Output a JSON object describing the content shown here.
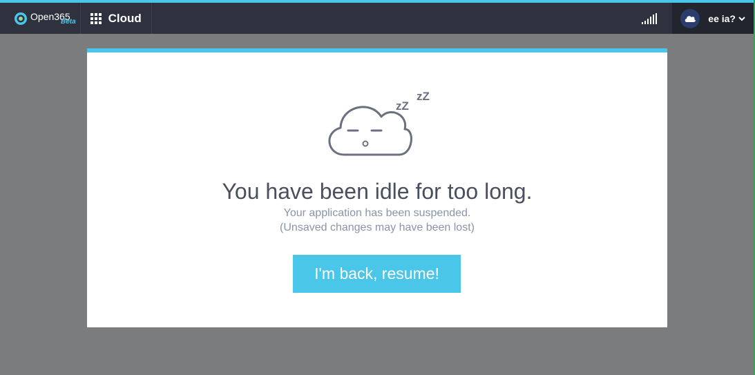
{
  "header": {
    "brand_name": "Open365",
    "brand_badge": "Beta",
    "app_label": "Cloud",
    "user_name": "ee ia?"
  },
  "colors": {
    "accent": "#4ac6e8",
    "topbar": "#2f323e",
    "backdrop": "#7b7c7e"
  },
  "idle": {
    "sleep_text_1": "zZ",
    "sleep_text_2": "zZ",
    "title": "You have been idle for too long.",
    "line1": "Your application has been suspended.",
    "line2": "(Unsaved changes may have been lost)",
    "resume_label": "I'm back, resume!"
  },
  "icons": [
    "open365-logo-icon",
    "apps-grid-icon",
    "signal-icon",
    "cloud-avatar-icon",
    "chevron-down-icon",
    "sleeping-cloud-icon"
  ]
}
